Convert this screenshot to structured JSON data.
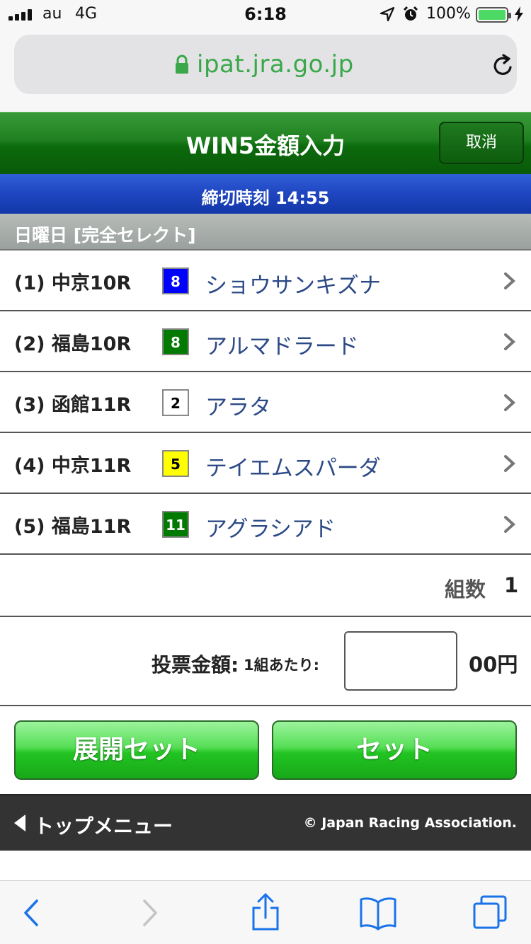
{
  "status_bar": {
    "carrier": "au",
    "network": "4G",
    "time": "6:18",
    "battery": "100%",
    "battery_level_pct": 100
  },
  "browser": {
    "url": "ipat.jra.go.jp"
  },
  "header": {
    "title": "WIN5金額入力",
    "cancel_label": "取消"
  },
  "deadline": {
    "text": "締切時刻 14:55"
  },
  "section": {
    "title": "日曜日 [完全セレクト]"
  },
  "races": [
    {
      "label": "(1) 中京10R",
      "number": "8",
      "horse": "ショウサンキズナ",
      "color": "#0000ff",
      "text_color": "#ffffff"
    },
    {
      "label": "(2) 福島10R",
      "number": "8",
      "horse": "アルマドラード",
      "color": "#007a00",
      "text_color": "#ffffff"
    },
    {
      "label": "(3) 函館11R",
      "number": "2",
      "horse": "アラタ",
      "color": "#ffffff",
      "text_color": "#000000"
    },
    {
      "label": "(4) 中京11R",
      "number": "5",
      "horse": "テイエムスパーダ",
      "color": "#ffff00",
      "text_color": "#000000"
    },
    {
      "label": "(5) 福島11R",
      "number": "11",
      "horse": "アグラシアド",
      "color": "#007a00",
      "text_color": "#ffffff"
    }
  ],
  "combination": {
    "label": "組数",
    "value": "1"
  },
  "amount": {
    "label": "投票金額:",
    "sub_label": "1組あたり:",
    "value": "",
    "unit": "00円"
  },
  "buttons": {
    "expand_set": "展開セット",
    "set": "セット"
  },
  "footer": {
    "top_menu": "トップメニュー",
    "copyright": "© Japan Racing Association."
  },
  "colors": {
    "header_green": "#1f801f",
    "deadline_blue": "#1f45c0",
    "horse_name": "#2c4a86",
    "url_green": "#3aa84a",
    "ios_blue": "#1a73e8"
  }
}
